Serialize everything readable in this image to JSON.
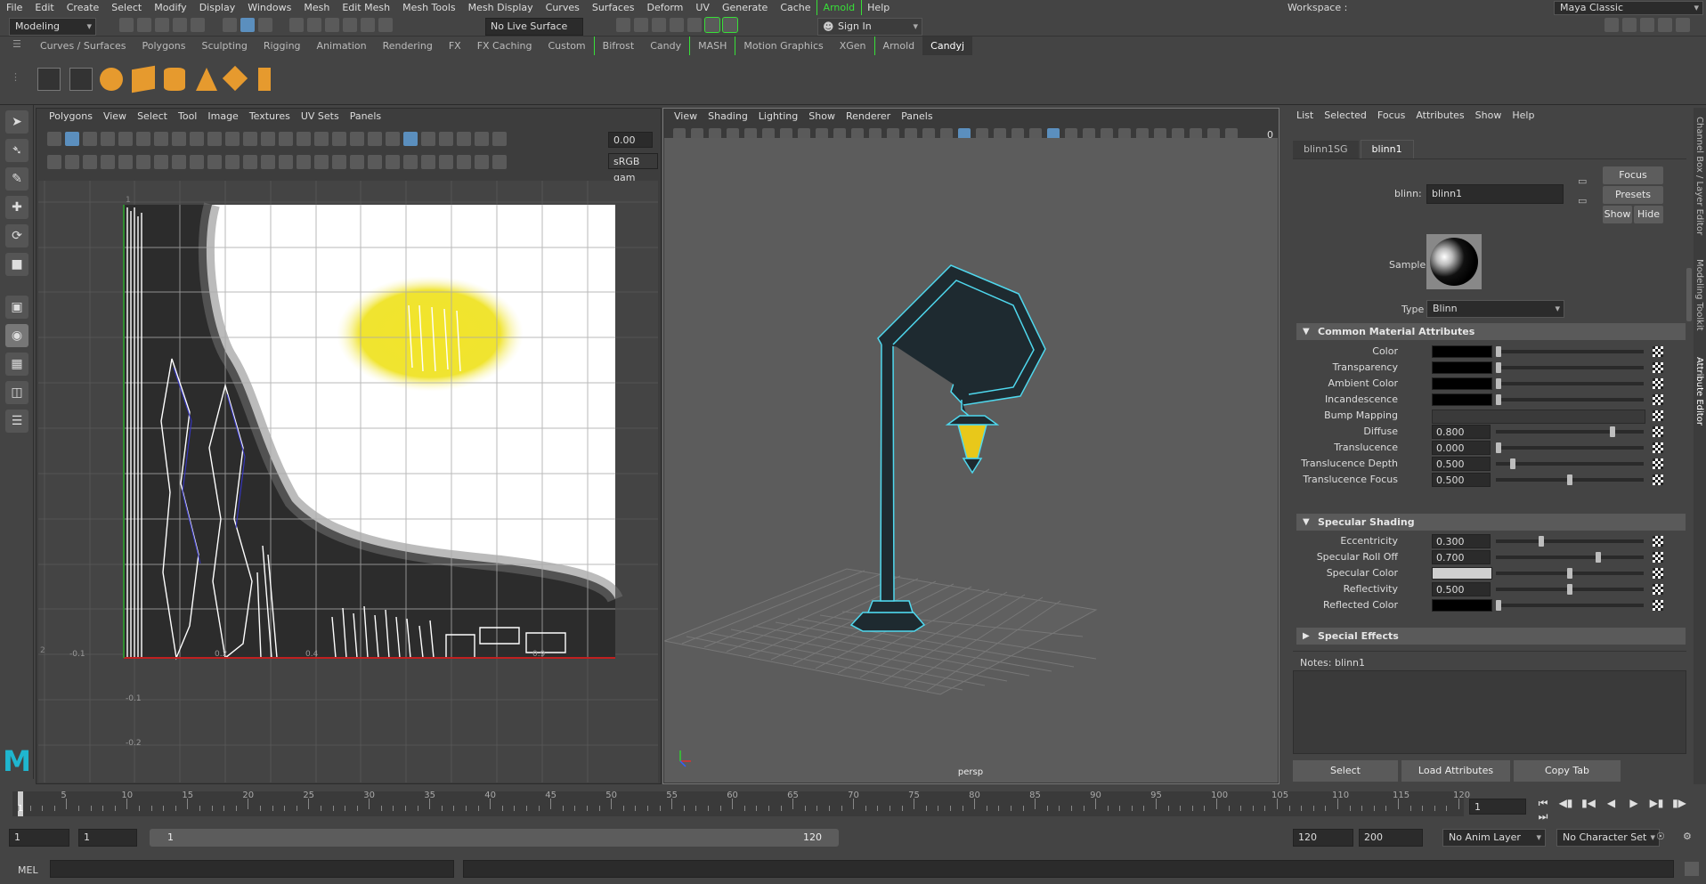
{
  "menu": [
    "File",
    "Edit",
    "Create",
    "Select",
    "Modify",
    "Display",
    "Windows",
    "Mesh",
    "Edit Mesh",
    "Mesh Tools",
    "Mesh Display",
    "Curves",
    "Surfaces",
    "Deform",
    "UV",
    "Generate",
    "Cache",
    "Arnold",
    "Help"
  ],
  "menu_highlight": "Arnold",
  "workspace": {
    "label": "Workspace :",
    "value": "Maya Classic"
  },
  "status": {
    "mode": "Modeling",
    "live_surface": "No Live Surface",
    "sign_in": "Sign In"
  },
  "shelf_tabs": [
    "Curves / Surfaces",
    "Polygons",
    "Sculpting",
    "Rigging",
    "Animation",
    "Rendering",
    "FX",
    "FX Caching",
    "Custom",
    "Bifrost",
    "Candy",
    "MASH",
    "Motion Graphics",
    "XGen",
    "Arnold",
    "Candyj"
  ],
  "shelf_active": "Candyj",
  "uv_editor": {
    "menus": [
      "Polygons",
      "View",
      "Select",
      "Tool",
      "Image",
      "Textures",
      "UV Sets",
      "Panels"
    ],
    "value_field": "0.00",
    "color_space": "sRGB gam",
    "axis_labels_x": [
      "-0.1",
      "0.2",
      "0.4",
      "0.9"
    ],
    "axis_labels_y": [
      "-0.1",
      "-0.2"
    ],
    "axis_top": "1",
    "axis_left": "2"
  },
  "viewport": {
    "menus": [
      "View",
      "Shading",
      "Lighting",
      "Show",
      "Renderer",
      "Panels"
    ],
    "camera_label": "persp",
    "field_value": "0"
  },
  "attribute_editor": {
    "menus": [
      "List",
      "Selected",
      "Focus",
      "Attributes",
      "Show",
      "Help"
    ],
    "tabs": [
      "blinn1SG",
      "blinn1"
    ],
    "active_tab": "blinn1",
    "name_label": "blinn:",
    "name_value": "blinn1",
    "focus_btn": "Focus",
    "presets_btn": "Presets",
    "show_btn": "Show",
    "hide_btn": "Hide",
    "sample_label": "Sample",
    "type_label": "Type",
    "type_value": "Blinn",
    "section_common": "Common Material Attributes",
    "common": [
      {
        "label": "Color",
        "kind": "swatch",
        "color": "#000000",
        "knob": 0.0
      },
      {
        "label": "Transparency",
        "kind": "swatch",
        "color": "#000000",
        "knob": 0.0
      },
      {
        "label": "Ambient Color",
        "kind": "swatch",
        "color": "#000000",
        "knob": 0.0
      },
      {
        "label": "Incandescence",
        "kind": "swatch",
        "color": "#000000",
        "knob": 0.0
      },
      {
        "label": "Bump Mapping",
        "kind": "bump"
      },
      {
        "label": "Diffuse",
        "kind": "value",
        "value": "0.800",
        "knob": 0.8
      },
      {
        "label": "Translucence",
        "kind": "value",
        "value": "0.000",
        "knob": 0.0
      },
      {
        "label": "Translucence Depth",
        "kind": "value",
        "value": "0.500",
        "knob": 0.1
      },
      {
        "label": "Translucence Focus",
        "kind": "value",
        "value": "0.500",
        "knob": 0.5
      }
    ],
    "section_specular": "Specular Shading",
    "specular": [
      {
        "label": "Eccentricity",
        "kind": "value",
        "value": "0.300",
        "knob": 0.3
      },
      {
        "label": "Specular Roll Off",
        "kind": "value",
        "value": "0.700",
        "knob": 0.7
      },
      {
        "label": "Specular Color",
        "kind": "swatch",
        "color": "#cfcfcf",
        "knob": 0.5
      },
      {
        "label": "Reflectivity",
        "kind": "value",
        "value": "0.500",
        "knob": 0.5
      },
      {
        "label": "Reflected Color",
        "kind": "swatch",
        "color": "#000000",
        "knob": 0.0
      }
    ],
    "section_effects": "Special Effects",
    "notes_label": "Notes:",
    "notes_value": "blinn1",
    "bottom_buttons": [
      "Select",
      "Load Attributes",
      "Copy Tab"
    ],
    "side_tabs": [
      "Channel Box / Layer Editor",
      "Modeling Toolkit",
      "Attribute Editor"
    ]
  },
  "timeline": {
    "ticks": [
      "5",
      "10",
      "15",
      "20",
      "25",
      "30",
      "35",
      "40",
      "45",
      "50",
      "55",
      "60",
      "65",
      "70",
      "75",
      "80",
      "85",
      "90",
      "95",
      "100",
      "105",
      "110",
      "115",
      "120"
    ],
    "current": "1",
    "current_field": "1"
  },
  "range": {
    "start": "1",
    "start2": "1",
    "slider_start": "1",
    "slider_end": "120",
    "end": "120",
    "end2": "200",
    "anim_layer": "No Anim Layer",
    "char_set": "No Character Set"
  },
  "cmd": {
    "label": "MEL"
  }
}
